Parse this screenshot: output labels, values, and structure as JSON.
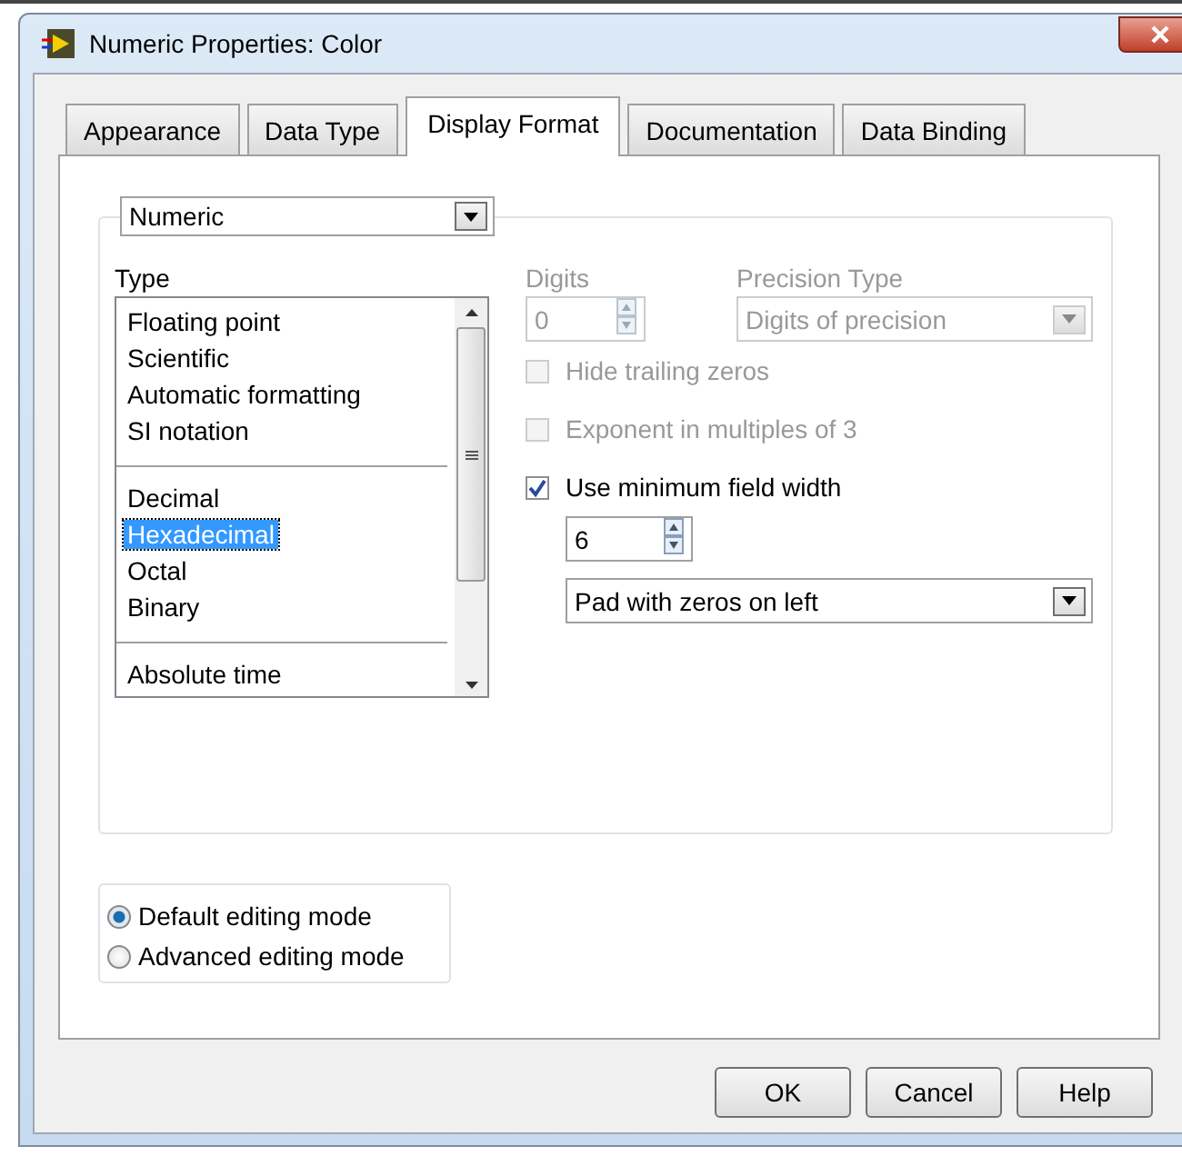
{
  "window": {
    "title": "Numeric Properties: Color"
  },
  "tabs": [
    {
      "label": "Appearance",
      "selected": false
    },
    {
      "label": "Data Type",
      "selected": false
    },
    {
      "label": "Display Format",
      "selected": true
    },
    {
      "label": "Documentation",
      "selected": false
    },
    {
      "label": "Data Binding",
      "selected": false
    }
  ],
  "category_dropdown": {
    "value": "Numeric"
  },
  "type": {
    "label": "Type",
    "groups": [
      [
        {
          "label": "Floating point",
          "selected": false
        },
        {
          "label": "Scientific",
          "selected": false
        },
        {
          "label": "Automatic formatting",
          "selected": false
        },
        {
          "label": "SI notation",
          "selected": false
        }
      ],
      [
        {
          "label": "Decimal",
          "selected": false
        },
        {
          "label": "Hexadecimal",
          "selected": true
        },
        {
          "label": "Octal",
          "selected": false
        },
        {
          "label": "Binary",
          "selected": false
        }
      ],
      [
        {
          "label": "Absolute time",
          "selected": false
        }
      ]
    ]
  },
  "digits": {
    "label": "Digits",
    "value": "0",
    "disabled": true
  },
  "precision_type": {
    "label": "Precision Type",
    "value": "Digits of precision",
    "disabled": true
  },
  "checkboxes": [
    {
      "label": "Hide trailing zeros",
      "checked": false,
      "disabled": true
    },
    {
      "label": "Exponent in multiples of 3",
      "checked": false,
      "disabled": true
    },
    {
      "label": "Use minimum field width",
      "checked": true,
      "disabled": false
    }
  ],
  "min_width": {
    "value": "6"
  },
  "padding_dropdown": {
    "value": "Pad with zeros on left"
  },
  "modes": [
    {
      "label": "Default editing mode",
      "selected": true
    },
    {
      "label": "Advanced editing mode",
      "selected": false
    }
  ],
  "buttons": [
    "OK",
    "Cancel",
    "Help"
  ]
}
